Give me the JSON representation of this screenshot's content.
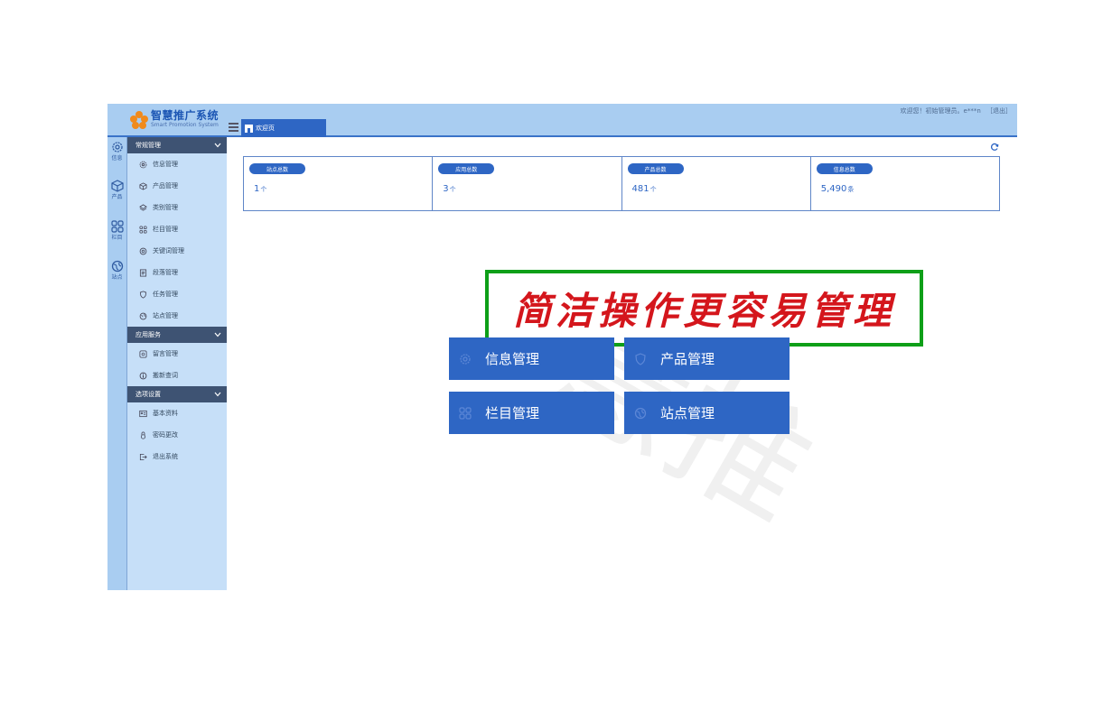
{
  "app": {
    "logo_title": "智慧推广系统",
    "logo_subtitle": "Smart Promotion System",
    "welcome": "欢迎您！初始管理员。e***n",
    "logout": "［退出］",
    "tab_home": "欢迎页"
  },
  "rail": [
    {
      "label": "信息",
      "icon": "gear-icon"
    },
    {
      "label": "产品",
      "icon": "cube-icon"
    },
    {
      "label": "栏目",
      "icon": "grid-icon"
    },
    {
      "label": "站点",
      "icon": "globe-icon"
    }
  ],
  "sidebar": {
    "groups": [
      {
        "title": "常规管理",
        "items": [
          "信息管理",
          "产品管理",
          "类别管理",
          "栏目管理",
          "关键词管理",
          "段落管理",
          "任务管理",
          "站点管理"
        ]
      },
      {
        "title": "应用服务",
        "items": [
          "留言管理",
          "搬新查词"
        ]
      },
      {
        "title": "选项设置",
        "items": [
          "基本资料",
          "密码更改",
          "退出系统"
        ]
      }
    ]
  },
  "stats": [
    {
      "label": "站点总数",
      "value": "1",
      "unit": "个"
    },
    {
      "label": "应用总数",
      "value": "3",
      "unit": "个"
    },
    {
      "label": "产品总数",
      "value": "481",
      "unit": "个"
    },
    {
      "label": "信息总数",
      "value": "5,490",
      "unit": "条"
    }
  ],
  "banner": "简洁操作更容易管理",
  "watermark": "慧推",
  "quick": [
    {
      "label": "信息管理",
      "icon": "gear-icon"
    },
    {
      "label": "产品管理",
      "icon": "shield-icon"
    },
    {
      "label": "栏目管理",
      "icon": "grid-icon"
    },
    {
      "label": "站点管理",
      "icon": "globe-icon"
    }
  ],
  "colors": {
    "accent": "#2e66c4",
    "topbar": "#a9cdf1",
    "sidebar": "#c6dff8",
    "sidebar_head": "#3e5373",
    "banner_border": "#0e9f18",
    "banner_text": "#d4161c"
  }
}
